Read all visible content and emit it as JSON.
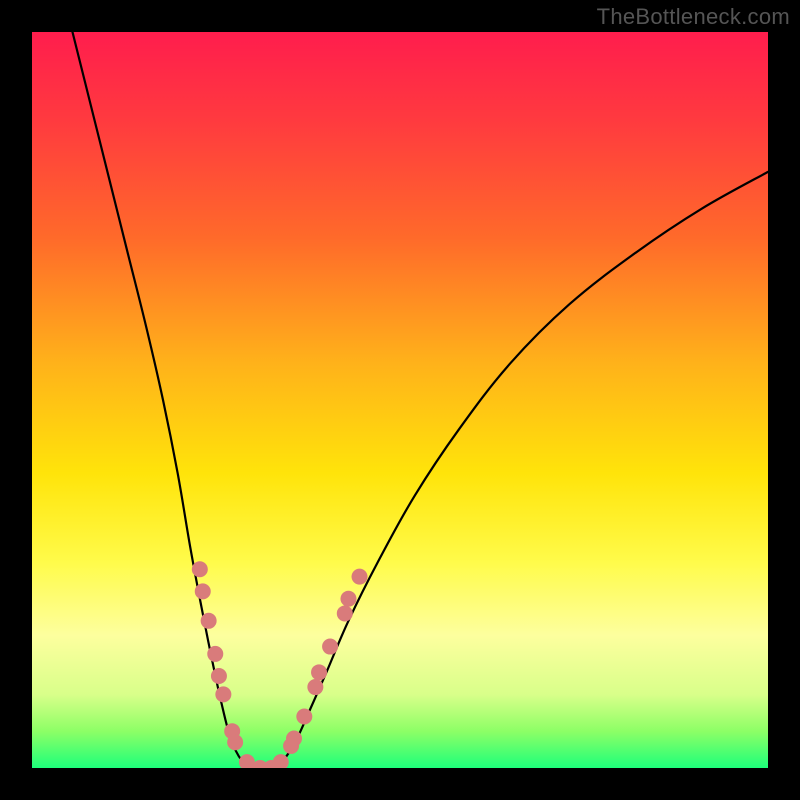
{
  "watermark": "TheBottleneck.com",
  "chart_data": {
    "type": "line",
    "title": "",
    "xlabel": "",
    "ylabel": "",
    "xlim": [
      0,
      100
    ],
    "ylim": [
      0,
      100
    ],
    "background_gradient": {
      "stops": [
        {
          "offset": 0.0,
          "color": "#ff1d4d"
        },
        {
          "offset": 0.12,
          "color": "#ff3a3f"
        },
        {
          "offset": 0.28,
          "color": "#ff6a2a"
        },
        {
          "offset": 0.45,
          "color": "#ffb21a"
        },
        {
          "offset": 0.6,
          "color": "#ffe40a"
        },
        {
          "offset": 0.72,
          "color": "#fffb4a"
        },
        {
          "offset": 0.82,
          "color": "#fdff9e"
        },
        {
          "offset": 0.9,
          "color": "#d9ff8a"
        },
        {
          "offset": 0.95,
          "color": "#8dff66"
        },
        {
          "offset": 1.0,
          "color": "#1dff7a"
        }
      ]
    },
    "series": [
      {
        "name": "left-curve",
        "color": "#000000",
        "width": 2.2,
        "points": [
          {
            "x": 5.5,
            "y": 100
          },
          {
            "x": 8.0,
            "y": 90
          },
          {
            "x": 10.5,
            "y": 80
          },
          {
            "x": 13.0,
            "y": 70
          },
          {
            "x": 15.5,
            "y": 60
          },
          {
            "x": 17.8,
            "y": 50
          },
          {
            "x": 19.8,
            "y": 40
          },
          {
            "x": 21.5,
            "y": 30
          },
          {
            "x": 23.0,
            "y": 22
          },
          {
            "x": 24.4,
            "y": 15
          },
          {
            "x": 25.7,
            "y": 9
          },
          {
            "x": 27.0,
            "y": 4
          },
          {
            "x": 28.5,
            "y": 1
          },
          {
            "x": 30.0,
            "y": 0
          }
        ]
      },
      {
        "name": "right-curve",
        "color": "#000000",
        "width": 2.2,
        "points": [
          {
            "x": 33.0,
            "y": 0
          },
          {
            "x": 34.5,
            "y": 1.5
          },
          {
            "x": 36.0,
            "y": 4
          },
          {
            "x": 37.8,
            "y": 8
          },
          {
            "x": 40.0,
            "y": 13
          },
          {
            "x": 43.0,
            "y": 20
          },
          {
            "x": 47.0,
            "y": 28
          },
          {
            "x": 52.0,
            "y": 37
          },
          {
            "x": 58.0,
            "y": 46
          },
          {
            "x": 65.0,
            "y": 55
          },
          {
            "x": 73.0,
            "y": 63
          },
          {
            "x": 82.0,
            "y": 70
          },
          {
            "x": 91.0,
            "y": 76
          },
          {
            "x": 100.0,
            "y": 81
          }
        ]
      },
      {
        "name": "bottom-connector",
        "color": "#000000",
        "width": 2.2,
        "points": [
          {
            "x": 30.0,
            "y": 0
          },
          {
            "x": 33.0,
            "y": 0
          }
        ]
      }
    ],
    "markers": {
      "color": "#d97b7b",
      "radius": 8,
      "points": [
        {
          "x": 22.8,
          "y": 27
        },
        {
          "x": 23.2,
          "y": 24
        },
        {
          "x": 24.0,
          "y": 20
        },
        {
          "x": 24.9,
          "y": 15.5
        },
        {
          "x": 25.4,
          "y": 12.5
        },
        {
          "x": 26.0,
          "y": 10
        },
        {
          "x": 27.2,
          "y": 5
        },
        {
          "x": 27.6,
          "y": 3.5
        },
        {
          "x": 29.2,
          "y": 0.8
        },
        {
          "x": 31.0,
          "y": 0
        },
        {
          "x": 32.5,
          "y": 0
        },
        {
          "x": 33.8,
          "y": 0.8
        },
        {
          "x": 35.2,
          "y": 3
        },
        {
          "x": 35.6,
          "y": 4
        },
        {
          "x": 37.0,
          "y": 7
        },
        {
          "x": 38.5,
          "y": 11
        },
        {
          "x": 39.0,
          "y": 13
        },
        {
          "x": 40.5,
          "y": 16.5
        },
        {
          "x": 42.5,
          "y": 21
        },
        {
          "x": 43.0,
          "y": 23
        },
        {
          "x": 44.5,
          "y": 26
        }
      ]
    }
  }
}
